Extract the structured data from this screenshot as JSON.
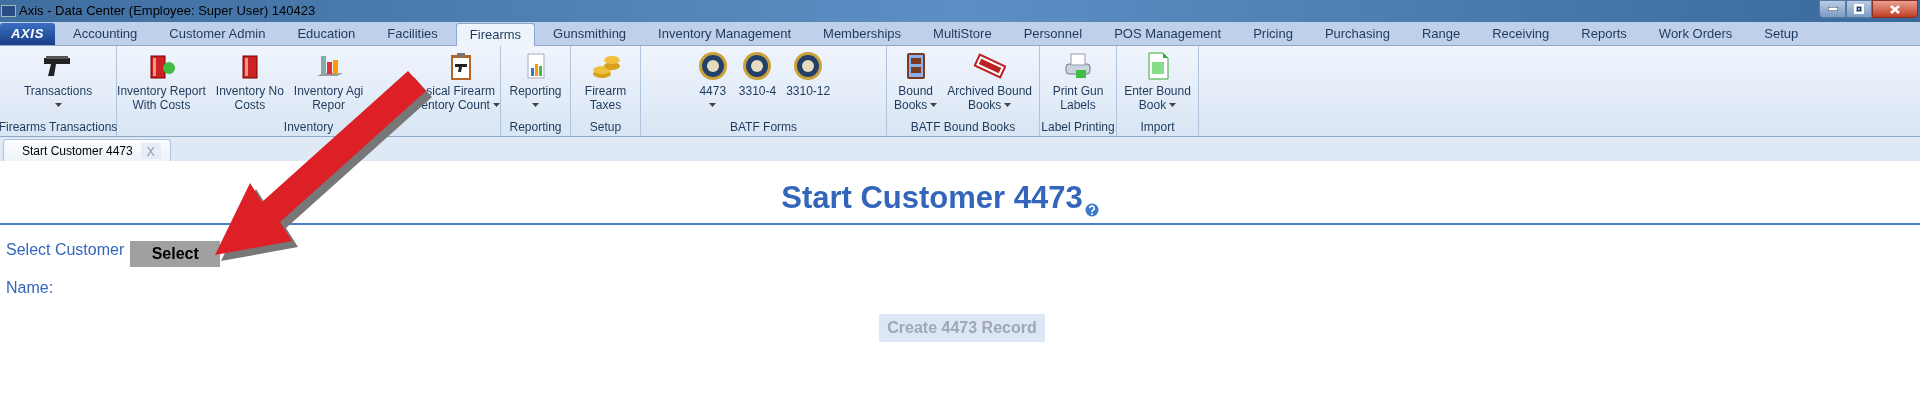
{
  "window": {
    "title": "Axis - Data Center  (Employee: Super User) 140423",
    "app_button": "AXIS"
  },
  "tabs": [
    {
      "label": "Accounting",
      "selected": false
    },
    {
      "label": "Customer Admin",
      "selected": false
    },
    {
      "label": "Education",
      "selected": false
    },
    {
      "label": "Facilities",
      "selected": false
    },
    {
      "label": "Firearms",
      "selected": true
    },
    {
      "label": "Gunsmithing",
      "selected": false
    },
    {
      "label": "Inventory Management",
      "selected": false
    },
    {
      "label": "Memberships",
      "selected": false
    },
    {
      "label": "MultiStore",
      "selected": false
    },
    {
      "label": "Personnel",
      "selected": false
    },
    {
      "label": "POS Management",
      "selected": false
    },
    {
      "label": "Pricing",
      "selected": false
    },
    {
      "label": "Purchasing",
      "selected": false
    },
    {
      "label": "Range",
      "selected": false
    },
    {
      "label": "Receiving",
      "selected": false
    },
    {
      "label": "Reports",
      "selected": false
    },
    {
      "label": "Work Orders",
      "selected": false
    },
    {
      "label": "Setup",
      "selected": false
    }
  ],
  "ribbon": {
    "groups": [
      {
        "label": "Firearms Transactions",
        "buttons": [
          {
            "lines": [
              "Transactions"
            ],
            "dropdown": true
          }
        ]
      },
      {
        "label": "Inventory",
        "buttons": [
          {
            "lines": [
              "Inventory Report",
              "With Costs"
            ],
            "dropdown": false
          },
          {
            "lines": [
              "Inventory No",
              "Costs"
            ],
            "dropdown": false
          },
          {
            "lines": [
              "Inventory Agi",
              "Repor"
            ],
            "dropdown": false
          },
          {
            "lines": [
              "sical Firearm",
              "entory Count"
            ],
            "dropdown": true
          }
        ]
      },
      {
        "label": "Reporting",
        "buttons": [
          {
            "lines": [
              "Reporting"
            ],
            "dropdown": true
          }
        ]
      },
      {
        "label": "Setup",
        "buttons": [
          {
            "lines": [
              "Firearm",
              "Taxes"
            ],
            "dropdown": false
          }
        ]
      },
      {
        "label": "BATF Forms",
        "buttons": [
          {
            "lines": [
              "4473"
            ],
            "dropdown": true
          },
          {
            "lines": [
              "3310-4"
            ],
            "dropdown": false
          },
          {
            "lines": [
              "3310-12"
            ],
            "dropdown": false
          }
        ]
      },
      {
        "label": "BATF Bound Books",
        "buttons": [
          {
            "lines": [
              "Bound",
              "Books"
            ],
            "dropdown": true
          },
          {
            "lines": [
              "Archived Bound",
              "Books"
            ],
            "dropdown": true
          }
        ]
      },
      {
        "label": "Label Printing",
        "buttons": [
          {
            "lines": [
              "Print Gun",
              "Labels"
            ],
            "dropdown": false
          }
        ]
      },
      {
        "label": "Import",
        "buttons": [
          {
            "lines": [
              "Enter Bound",
              "Book"
            ],
            "dropdown": true
          }
        ]
      }
    ]
  },
  "document_tabs": [
    {
      "label": "Start Customer 4473",
      "close": "X",
      "selected": true
    }
  ],
  "form": {
    "heading": "Start Customer 4473",
    "select_label": "Select Customer",
    "select_button": "Select",
    "name_label": "Name:",
    "create_button": {
      "label": "Create 4473 Record",
      "disabled": true
    }
  }
}
